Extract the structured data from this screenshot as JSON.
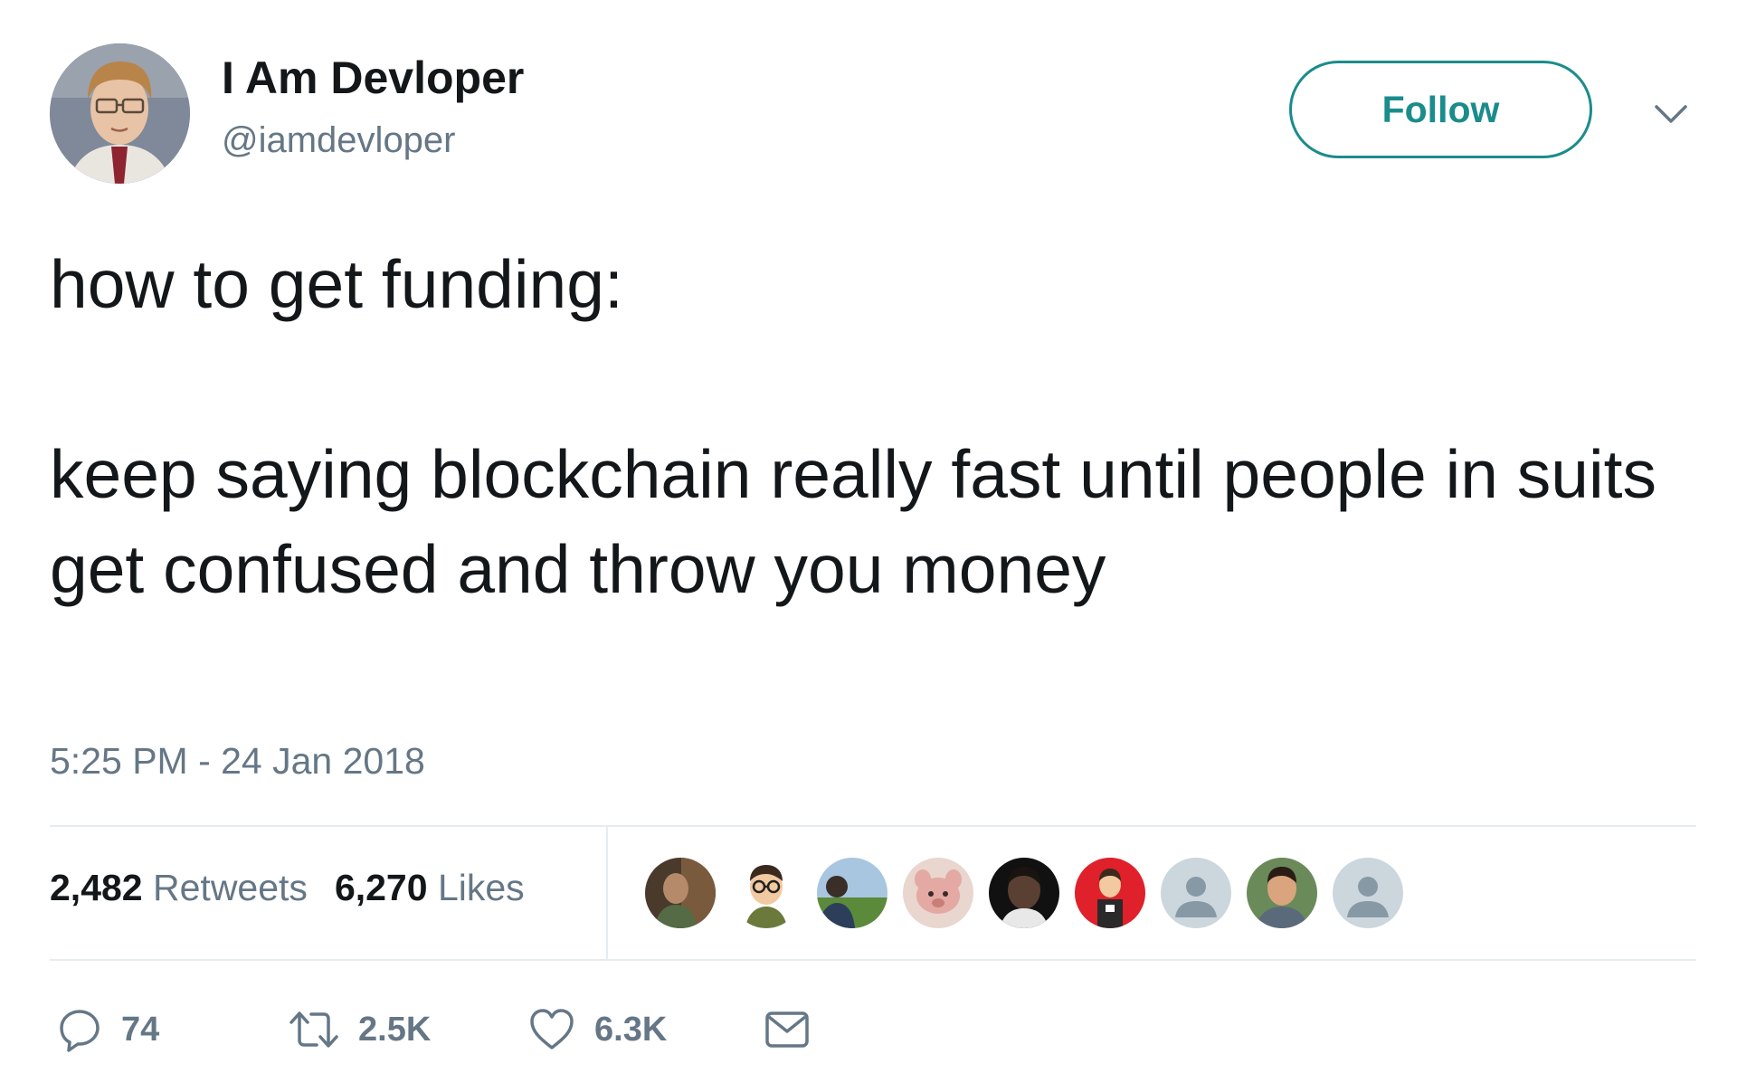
{
  "tweet": {
    "author": {
      "display_name": "I Am Devloper",
      "handle": "@iamdevloper"
    },
    "follow_label": "Follow",
    "text": {
      "line1": "how to get funding:",
      "line2": "keep saying blockchain really fast until people in suits get confused and throw you money"
    },
    "timestamp": "5:25 PM - 24 Jan 2018",
    "stats": {
      "retweets_count": "2,482",
      "retweets_label": "Retweets",
      "likes_count": "6,270",
      "likes_label": "Likes"
    },
    "actions": {
      "reply_count": "74",
      "retweet_count": "2.5K",
      "like_count": "6.3K"
    }
  },
  "colors": {
    "accent": "#1b8c8c",
    "secondary_text": "#657786",
    "primary_text": "#14171a",
    "divider": "#e6ecf0"
  },
  "icons": [
    "chevron-down-icon",
    "reply-icon",
    "retweet-icon",
    "heart-icon",
    "message-icon",
    "default-avatar-icon"
  ]
}
